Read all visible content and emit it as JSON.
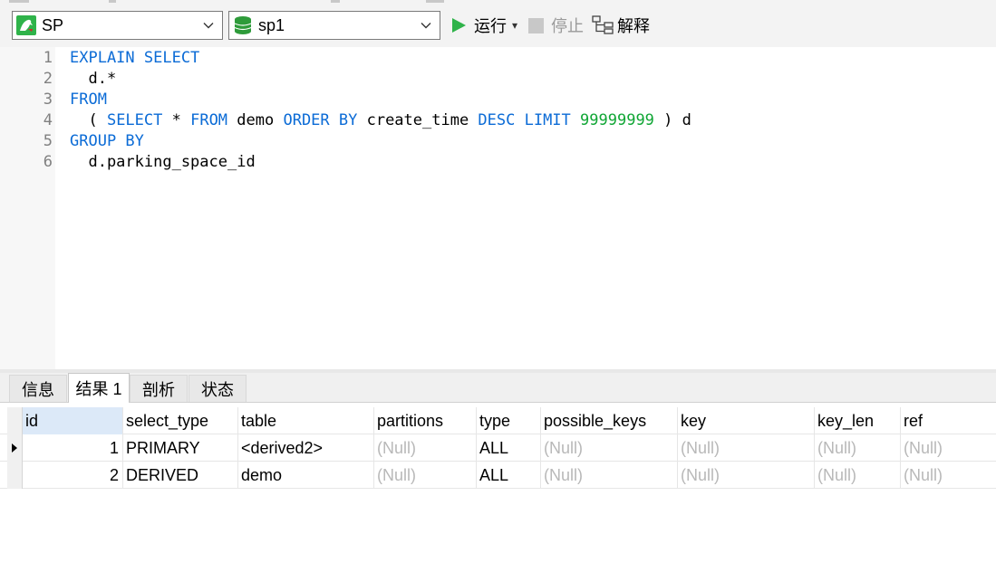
{
  "toolbar": {
    "connection": "SP",
    "database": "sp1",
    "run_label": "运行",
    "run_dropdown": "▾",
    "stop_label": "停止",
    "explain_label": "解释",
    "accent_run": "#2fb34a",
    "accent_db": "#2e9b3a",
    "accent_conn": "#2fb34a"
  },
  "editor": {
    "lines": [
      {
        "num": "1",
        "parts": [
          {
            "t": "EXPLAIN SELECT",
            "k": "kw"
          }
        ]
      },
      {
        "num": "2",
        "parts": [
          {
            "t": "  d.*",
            "k": ""
          }
        ]
      },
      {
        "num": "3",
        "parts": [
          {
            "t": "FROM",
            "k": "kw"
          }
        ]
      },
      {
        "num": "4",
        "parts": [
          {
            "t": "  ( ",
            "k": ""
          },
          {
            "t": "SELECT",
            "k": "kw"
          },
          {
            "t": " * ",
            "k": ""
          },
          {
            "t": "FROM",
            "k": "kw"
          },
          {
            "t": " demo ",
            "k": ""
          },
          {
            "t": "ORDER BY",
            "k": "kw"
          },
          {
            "t": " create_time ",
            "k": ""
          },
          {
            "t": "DESC LIMIT",
            "k": "kw"
          },
          {
            "t": " ",
            "k": ""
          },
          {
            "t": "99999999",
            "k": "num"
          },
          {
            "t": " ) d",
            "k": ""
          }
        ]
      },
      {
        "num": "5",
        "parts": [
          {
            "t": "GROUP BY",
            "k": "kw"
          }
        ]
      },
      {
        "num": "6",
        "parts": [
          {
            "t": "  d.parking_space_id",
            "k": ""
          }
        ]
      }
    ]
  },
  "tabs": [
    "信息",
    "结果 1",
    "剖析",
    "状态"
  ],
  "result": {
    "columns": [
      "id",
      "select_type",
      "table",
      "partitions",
      "type",
      "possible_keys",
      "key",
      "key_len",
      "ref"
    ],
    "rows": [
      [
        "1",
        "PRIMARY",
        "<derived2>",
        "(Null)",
        "ALL",
        "(Null)",
        "(Null)",
        "(Null)",
        "(Null)"
      ],
      [
        "2",
        "DERIVED",
        "demo",
        "(Null)",
        "ALL",
        "(Null)",
        "(Null)",
        "(Null)",
        "(Null)"
      ]
    ]
  }
}
